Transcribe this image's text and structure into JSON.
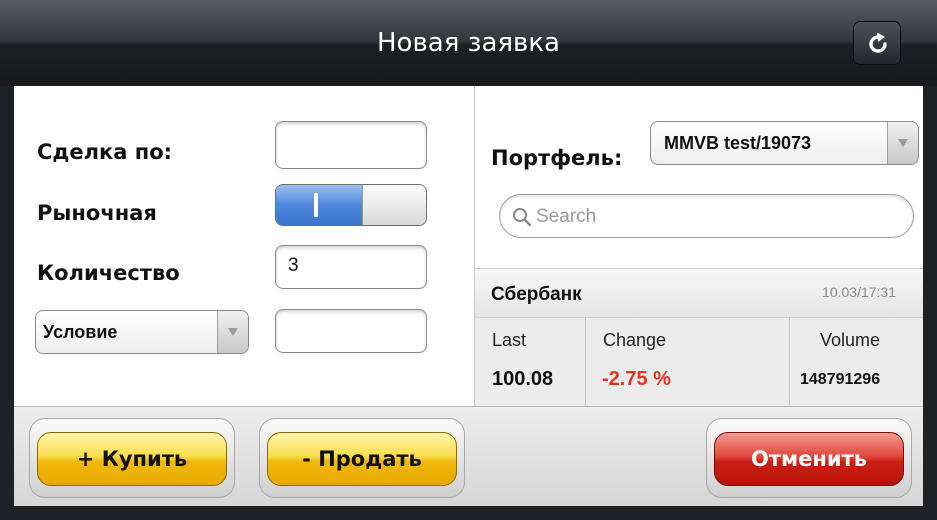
{
  "header": {
    "title": "Новая заявка",
    "refresh_icon": "refresh-icon"
  },
  "order": {
    "deal_label": "Сделка по:",
    "deal_value": "",
    "market_label": "Рыночная",
    "market_toggle_on": true,
    "quantity_label": "Количество",
    "quantity_value": "3",
    "condition_select": "Условие",
    "condition_value": ""
  },
  "portfolio": {
    "label": "Портфель:",
    "selected": "MMVB test/19073",
    "search_placeholder": "Search"
  },
  "ticker": {
    "name": "Сбербанк",
    "time": "10.03/17:31",
    "last_label": "Last",
    "last_value": "100.08",
    "change_label": "Change",
    "change_value": "-2.75 %",
    "volume_label": "Volume",
    "volume_value": "148791296"
  },
  "actions": {
    "buy_label": "+ Купить",
    "sell_label": "- Продать",
    "cancel_label": "Отменить"
  },
  "colors": {
    "negative_change": "#e8331c",
    "toggle_on": "#4f89dc",
    "buy_sell": "#f0b90c",
    "cancel": "#cc1f14"
  }
}
